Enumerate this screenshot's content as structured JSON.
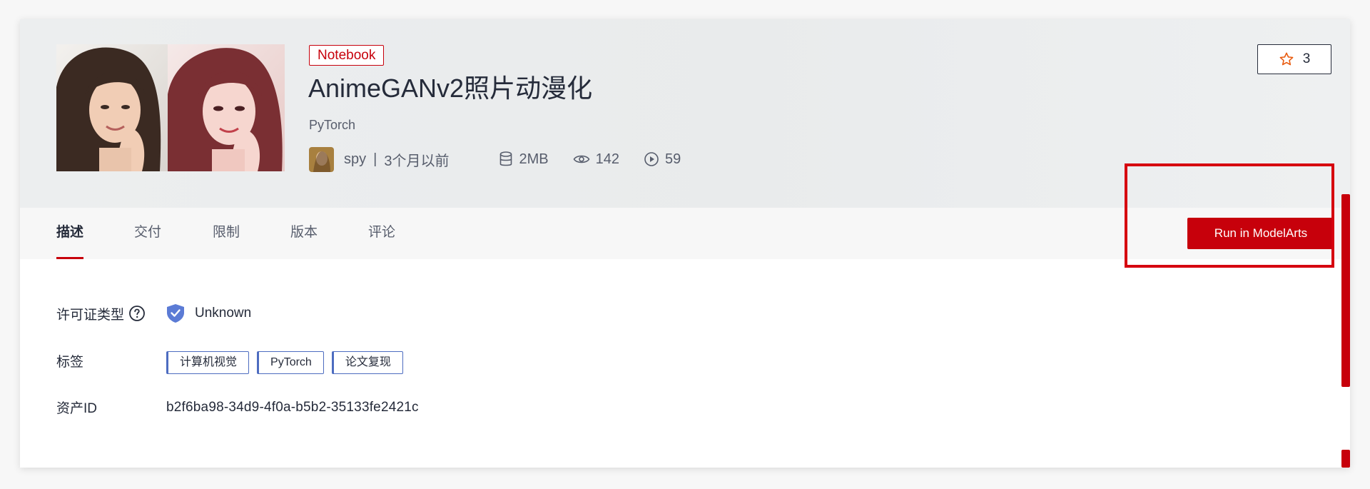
{
  "header": {
    "type_badge": "Notebook",
    "title": "AnimeGANv2照片动漫化",
    "framework": "PyTorch",
    "author": "spy",
    "separator": "|",
    "time_ago": "3个月以前",
    "size": "2MB",
    "views": "142",
    "runs": "59",
    "star_count": "3"
  },
  "tabs": [
    {
      "label": "描述"
    },
    {
      "label": "交付"
    },
    {
      "label": "限制"
    },
    {
      "label": "版本"
    },
    {
      "label": "评论"
    }
  ],
  "actions": {
    "run_label": "Run in ModelArts"
  },
  "details": {
    "license_label": "许可证类型",
    "license_value": "Unknown",
    "tags_label": "标签",
    "tags": [
      "计算机视觉",
      "PyTorch",
      "论文复现"
    ],
    "asset_label": "资产ID",
    "asset_value": "b2f6ba98-34d9-4f0a-b5b2-35133fe2421c"
  },
  "icons": {
    "star": "star-icon",
    "storage": "database-icon",
    "views": "eye-icon",
    "runs": "play-circle-icon",
    "license": "shield-check-icon",
    "help": "question-circle-icon"
  },
  "colors": {
    "accent": "#c7000b",
    "tag_border": "#4d6cc0",
    "text": "#252b3a",
    "muted": "#575d6c"
  }
}
